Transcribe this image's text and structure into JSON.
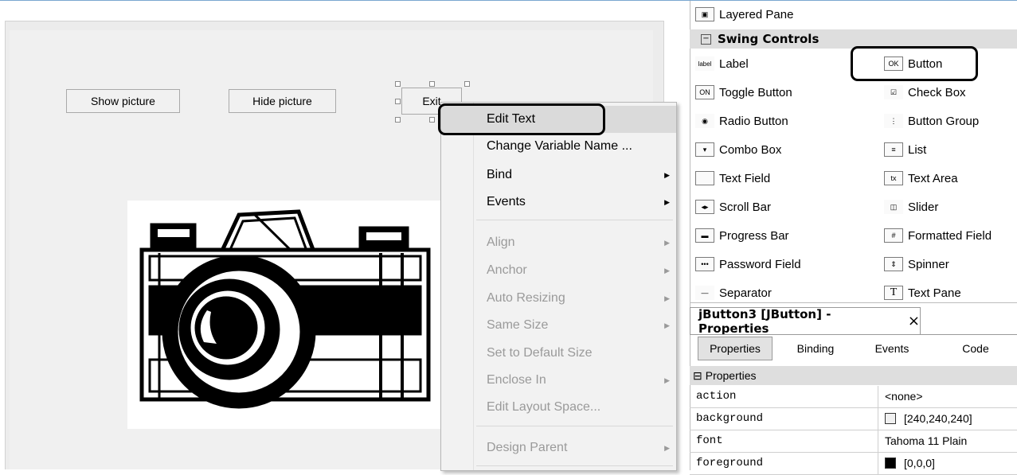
{
  "design_form": {
    "buttons": {
      "show_picture": "Show picture",
      "hide_picture": "Hide picture",
      "exit": "Exit"
    }
  },
  "context_menu": {
    "items": [
      {
        "label": "Edit Text",
        "enabled": true,
        "submenu": false,
        "highlighted": true
      },
      {
        "label": "Change Variable Name ...",
        "enabled": true,
        "submenu": false
      },
      {
        "label": "Bind",
        "enabled": true,
        "submenu": true
      },
      {
        "label": "Events",
        "enabled": true,
        "submenu": true
      },
      {
        "label": "Align",
        "enabled": false,
        "submenu": true
      },
      {
        "label": "Anchor",
        "enabled": false,
        "submenu": true
      },
      {
        "label": "Auto Resizing",
        "enabled": false,
        "submenu": true
      },
      {
        "label": "Same Size",
        "enabled": false,
        "submenu": true
      },
      {
        "label": "Set to Default Size",
        "enabled": false,
        "submenu": false
      },
      {
        "label": "Enclose In",
        "enabled": false,
        "submenu": true
      },
      {
        "label": "Edit Layout Space...",
        "enabled": false,
        "submenu": false
      },
      {
        "label": "Design Parent",
        "enabled": false,
        "submenu": true
      }
    ]
  },
  "palette": {
    "top_item": {
      "label": "Layered Pane",
      "icon": "layered-pane-icon"
    },
    "group_header": "Swing Controls",
    "items": [
      {
        "label": "Label",
        "icon_text": "label"
      },
      {
        "label": "Button",
        "icon_text": "OK"
      },
      {
        "label": "Toggle Button",
        "icon_text": "ON"
      },
      {
        "label": "Check Box",
        "icon_text": "☑"
      },
      {
        "label": "Radio Button",
        "icon_text": "◉"
      },
      {
        "label": "Button Group",
        "icon_text": "⋮"
      },
      {
        "label": "Combo Box",
        "icon_text": "▾"
      },
      {
        "label": "List",
        "icon_text": "≡"
      },
      {
        "label": "Text Field",
        "icon_text": ""
      },
      {
        "label": "Text Area",
        "icon_text": "tx"
      },
      {
        "label": "Scroll Bar",
        "icon_text": "◂▸"
      },
      {
        "label": "Slider",
        "icon_text": "◫"
      },
      {
        "label": "Progress Bar",
        "icon_text": "▬"
      },
      {
        "label": "Formatted Field",
        "icon_text": "#"
      },
      {
        "label": "Password Field",
        "icon_text": "•••"
      },
      {
        "label": "Spinner",
        "icon_text": "⇕"
      },
      {
        "label": "Separator",
        "icon_text": "—"
      },
      {
        "label": "Text Pane",
        "icon_text": "T"
      }
    ]
  },
  "properties": {
    "window_title": "jButton3 [JButton] - Properties",
    "close": "×",
    "tabs": [
      "Properties",
      "Binding",
      "Events",
      "Code"
    ],
    "section": "Properties",
    "section_toggle": "⊟",
    "rows": [
      {
        "key": "action",
        "value": "<none>"
      },
      {
        "key": "background",
        "value": "[240,240,240]",
        "swatch": "#f0f0f0"
      },
      {
        "key": "font",
        "value": "Tahoma 11 Plain"
      },
      {
        "key": "foreground",
        "value": "[0,0,0]",
        "swatch": "#000000"
      }
    ]
  }
}
